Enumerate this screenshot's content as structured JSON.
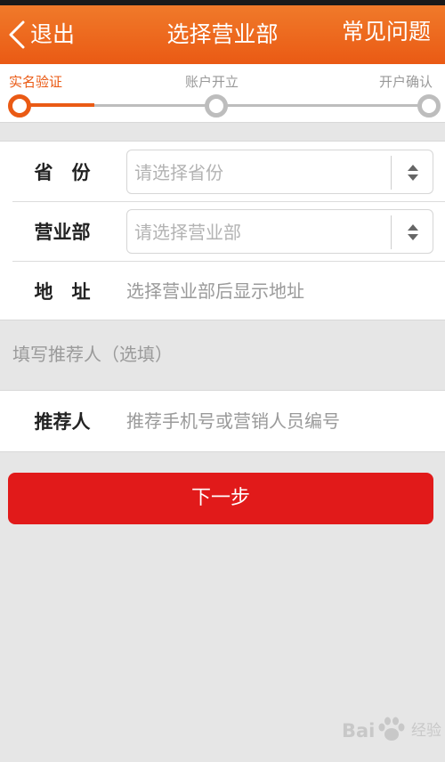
{
  "header": {
    "back_label": "退出",
    "title": "选择营业部",
    "faq_label": "常见问题"
  },
  "steps": [
    {
      "label": "实名验证",
      "active": true
    },
    {
      "label": "账户开立",
      "active": false
    },
    {
      "label": "开户确认",
      "active": false
    }
  ],
  "form": {
    "province": {
      "label": "省　份",
      "placeholder": "请选择省份"
    },
    "branch": {
      "label": "营业部",
      "placeholder": "请选择营业部"
    },
    "address": {
      "label": "地　址",
      "value": "选择营业部后显示地址"
    }
  },
  "referrer_section": {
    "title": "填写推荐人（选填）",
    "label": "推荐人",
    "placeholder": "推荐手机号或营销人员编号"
  },
  "next_button": "下一步",
  "watermark": {
    "left": "Bai",
    "right": "经验"
  },
  "colors": {
    "accent": "#ea5a14",
    "button": "#e11a1a",
    "background": "#e6e6e6"
  }
}
